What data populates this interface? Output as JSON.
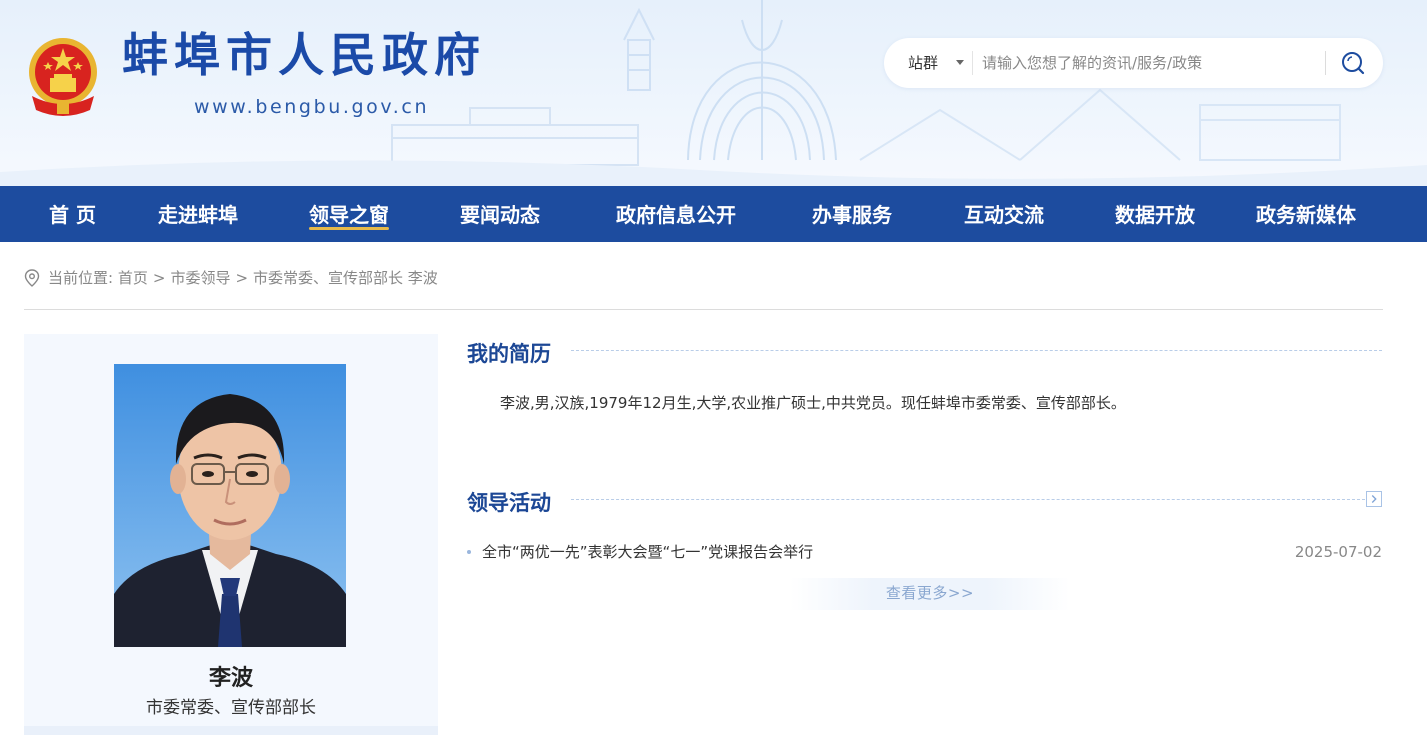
{
  "header": {
    "site_title": "蚌埠市人民政府",
    "site_url": "www.bengbu.gov.cn",
    "search": {
      "scope_label": "站群",
      "placeholder": "请输入您想了解的资讯/服务/政策"
    }
  },
  "nav": {
    "items": [
      {
        "label": "首 页",
        "active": false
      },
      {
        "label": "走进蚌埠",
        "active": false
      },
      {
        "label": "领导之窗",
        "active": true
      },
      {
        "label": "要闻动态",
        "active": false
      },
      {
        "label": "政府信息公开",
        "active": false
      },
      {
        "label": "办事服务",
        "active": false
      },
      {
        "label": "互动交流",
        "active": false
      },
      {
        "label": "数据开放",
        "active": false
      },
      {
        "label": "政务新媒体",
        "active": false
      }
    ]
  },
  "breadcrumb": {
    "prefix": "当前位置:",
    "items": [
      "首页",
      "市委领导",
      "市委常委、宣传部部长 李波"
    ],
    "separator": ">"
  },
  "profile": {
    "name": "李波",
    "title": "市委常委、宣传部部长"
  },
  "resume": {
    "heading": "我的简历",
    "text": "李波,男,汉族,1979年12月生,大学,农业推广硕士,中共党员。现任蚌埠市委常委、宣传部部长。"
  },
  "activities": {
    "heading": "领导活动",
    "items": [
      {
        "title": "全市“两优一先”表彰大会暨“七一”党课报告会举行",
        "date": "2025-07-02"
      }
    ],
    "more_label": "查看更多>>"
  },
  "colors": {
    "brand_blue": "#1d4c9f",
    "title_blue": "#1b4aa8",
    "nav_active_underline": "#e6b94a"
  }
}
